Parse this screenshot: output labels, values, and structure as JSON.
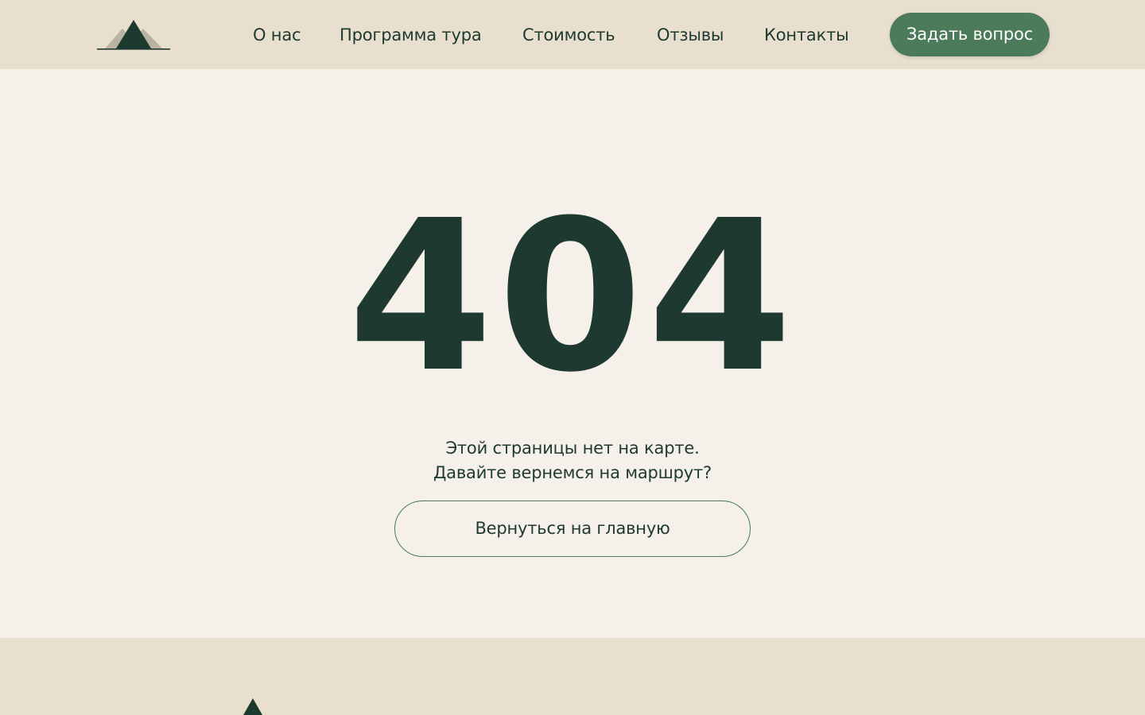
{
  "header": {
    "logo_icon": "mountain-logo-icon",
    "nav": [
      {
        "label": "О нас"
      },
      {
        "label": "Программа тура"
      },
      {
        "label": "Стоимость"
      },
      {
        "label": "Отзывы"
      },
      {
        "label": "Контакты"
      }
    ],
    "cta_label": "Задать вопрос"
  },
  "main": {
    "error_code": "404",
    "message_line1": "Этой страницы нет на карте.",
    "message_line2": "Давайте вернемся на маршрут?",
    "home_button_label": "Вернуться на главную"
  },
  "footer": {
    "logo_icon": "mountain-logo-icon"
  },
  "colors": {
    "header_bg": "#e8dfcf",
    "page_bg": "#f5f0e9",
    "dark_green": "#1e3a30",
    "accent_green": "#4b7b5a",
    "mountain_light": "#b9b3a3"
  }
}
